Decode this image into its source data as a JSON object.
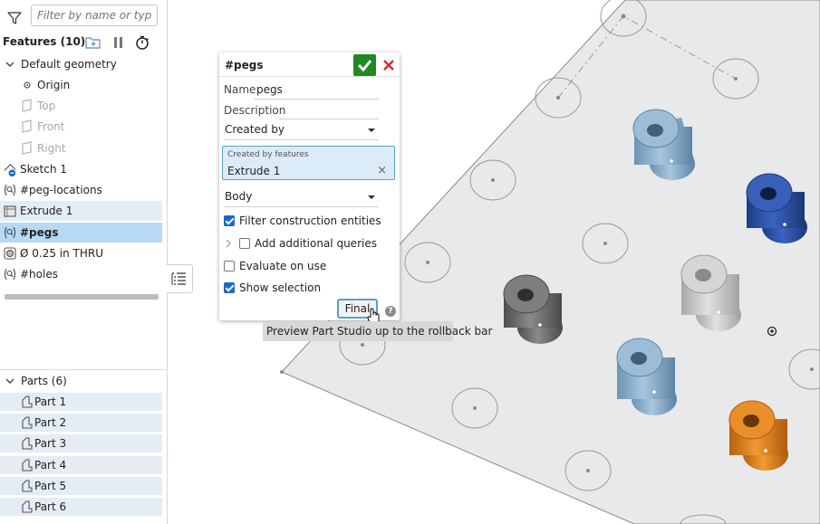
{
  "filter": {
    "placeholder": "Filter by name or type",
    "icon": "filter-icon"
  },
  "features": {
    "title": "Features (10)",
    "icons": [
      "add-folder-icon",
      "pause-icon",
      "stopwatch-icon"
    ],
    "default_geometry": "Default geometry",
    "geometry_items": [
      "Origin",
      "Top",
      "Front",
      "Right"
    ],
    "items": [
      {
        "label": "Sketch 1",
        "icon": "sketch-icon"
      },
      {
        "label": "#peg-locations",
        "icon": "query-variable-icon"
      },
      {
        "label": "Extrude 1",
        "icon": "extrude-icon"
      },
      {
        "label": "#pegs",
        "icon": "query-variable-icon"
      },
      {
        "label": "Ø 0.25 in THRU",
        "icon": "hole-icon"
      },
      {
        "label": "#holes",
        "icon": "query-variable-icon"
      }
    ]
  },
  "parts": {
    "title": "Parts (6)",
    "items": [
      "Part 1",
      "Part 2",
      "Part 3",
      "Part 4",
      "Part 5",
      "Part 6"
    ]
  },
  "dialog": {
    "title": "#pegs",
    "name_label": "Name",
    "name_value": "pegs",
    "description_label": "Description",
    "query_type": "Created by",
    "query_box_label": "Created by features",
    "query_box_value": "Extrude 1",
    "entity_type": "Body",
    "options": [
      {
        "label": "Filter construction entities",
        "checked": true
      },
      {
        "label": "Add additional queries",
        "checked": false
      },
      {
        "label": "Evaluate on use",
        "checked": false
      },
      {
        "label": "Show selection",
        "checked": true
      }
    ],
    "final_label": "Final",
    "help": "?"
  },
  "tooltip": "Preview Part Studio up to the rollback bar",
  "colors": {
    "accent_blue": "#1f67c4",
    "ok_green": "#1f8a23",
    "cancel_red": "#d42a2a",
    "peg_light_blue": "#8fb3cf",
    "peg_dark_blue": "#2c4fa0",
    "peg_gray": "#6e6e6e",
    "peg_silver": "#c6c6c6",
    "peg_orange": "#d77b17"
  }
}
